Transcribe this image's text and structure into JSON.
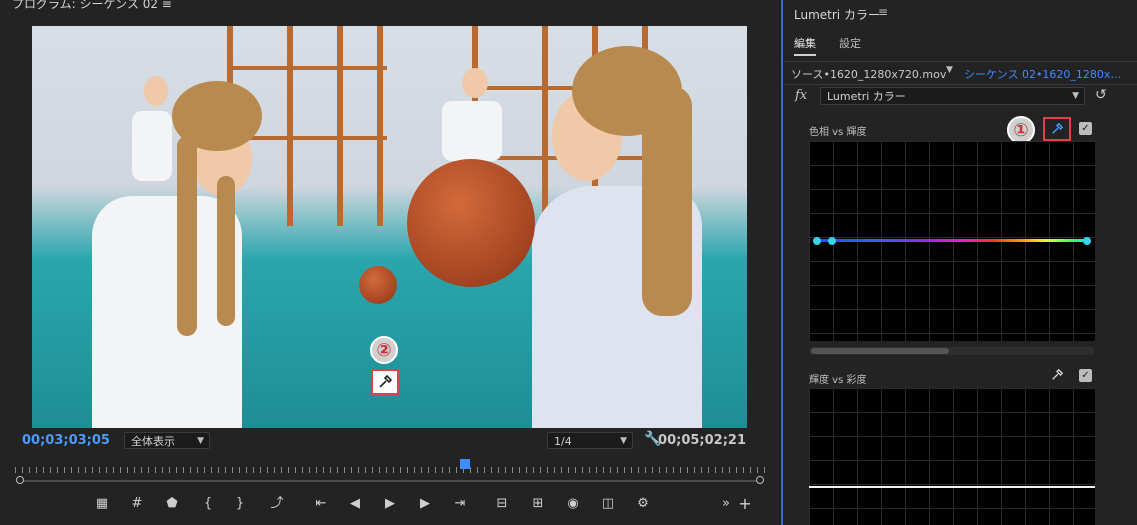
{
  "monitor": {
    "title": "プログラム: シーケンス 02 ≡",
    "timecode_current": "00;03;03;05",
    "zoom_select": "全体表示",
    "resolution_select": "1/4",
    "timecode_duration": "00;05;02;21",
    "callout_2": "②"
  },
  "lumetri": {
    "panel_title": "Lumetri カラー",
    "panel_menu": "≡",
    "tabs": [
      "編集",
      "設定"
    ],
    "source_label": "ソース•1620_1280x720.mov",
    "sequence_label": "シーケンス 02•1620_1280x…",
    "fx_label": "fx",
    "effect_select": "Lumetri カラー",
    "callout_1": "①",
    "curve1_label": "色相 vs 輝度",
    "curve2_label": "輝度 vs 彩度",
    "checkmark": "✓"
  },
  "colors": {
    "accent_blue": "#3d8bff",
    "highlight_red": "#e0404a",
    "panel_bg": "#232323"
  }
}
